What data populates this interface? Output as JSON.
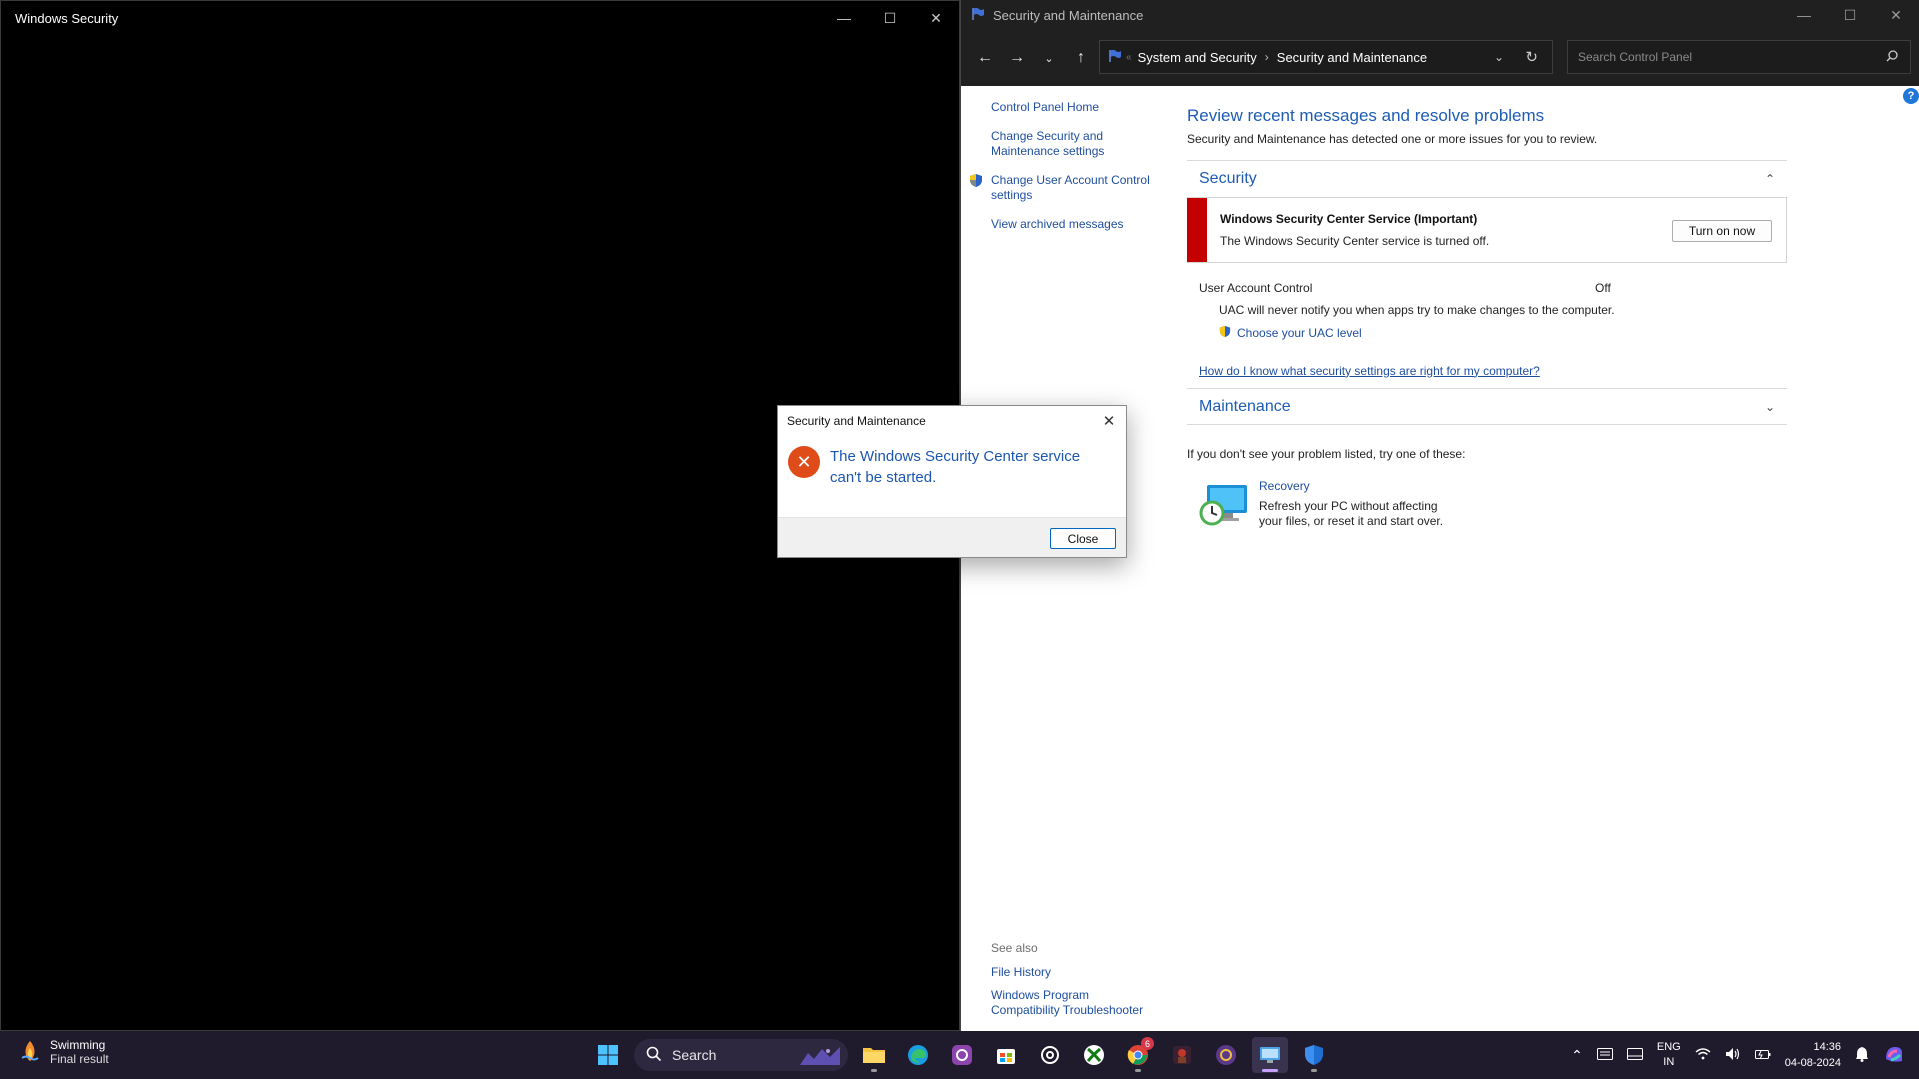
{
  "left_window": {
    "title": "Windows Security"
  },
  "control_panel": {
    "window_title": "Security and Maintenance",
    "breadcrumb": [
      "System and Security",
      "Security and Maintenance"
    ],
    "breadcrumb_overflow": "«",
    "search_placeholder": "Search Control Panel",
    "left_links": {
      "home": "Control Panel Home",
      "change_settings": "Change Security and Maintenance settings",
      "change_uac": "Change User Account Control settings",
      "archived": "View archived messages"
    },
    "see_also": {
      "header": "See also",
      "file_history": "File History",
      "compat": "Windows Program Compatibility Troubleshooter"
    },
    "main": {
      "heading": "Review recent messages and resolve problems",
      "subheading": "Security and Maintenance has detected one or more issues for you to review.",
      "security_header": "Security",
      "alert": {
        "title": "Windows Security Center Service  (Important)",
        "description": "The Windows Security Center service is turned off.",
        "button": "Turn on now",
        "bar_color": "#c40000"
      },
      "uac": {
        "label": "User Account Control",
        "value": "Off",
        "message": "UAC will never notify you when apps try to make changes to the computer.",
        "link": "Choose your UAC level"
      },
      "help_link": "How do I know what security settings are right for my computer?",
      "maintenance_header": "Maintenance",
      "try_line": "If you don't see your problem listed, try one of these:",
      "recovery": {
        "title": "Recovery",
        "description": "Refresh your PC without affecting your files, or reset it and start over."
      },
      "help_button": "?"
    }
  },
  "dialog": {
    "title": "Security and Maintenance",
    "message": "The Windows Security Center service can't be started.",
    "close_button": "Close",
    "error_icon_color": "#e04b1a"
  },
  "taskbar": {
    "weather": {
      "title": "Swimming",
      "subtitle": "Final result"
    },
    "search_label": "Search",
    "chrome_badge": "6",
    "language": {
      "line1": "ENG",
      "line2": "IN"
    },
    "time": "14:36",
    "date": "04-08-2024",
    "pinned_icons": [
      "start-icon",
      "file-explorer-icon",
      "edge-icon",
      "app-icon",
      "store-icon",
      "chatgpt-icon",
      "xbox-icon",
      "chrome-icon",
      "game-icon",
      "app2-icon",
      "control-panel-icon",
      "defender-icon"
    ]
  },
  "colors": {
    "accent": "#1e5cb3",
    "link": "#1e4e9e",
    "taskbar": "#1f1a2c",
    "titlebar_dark": "#202020"
  }
}
